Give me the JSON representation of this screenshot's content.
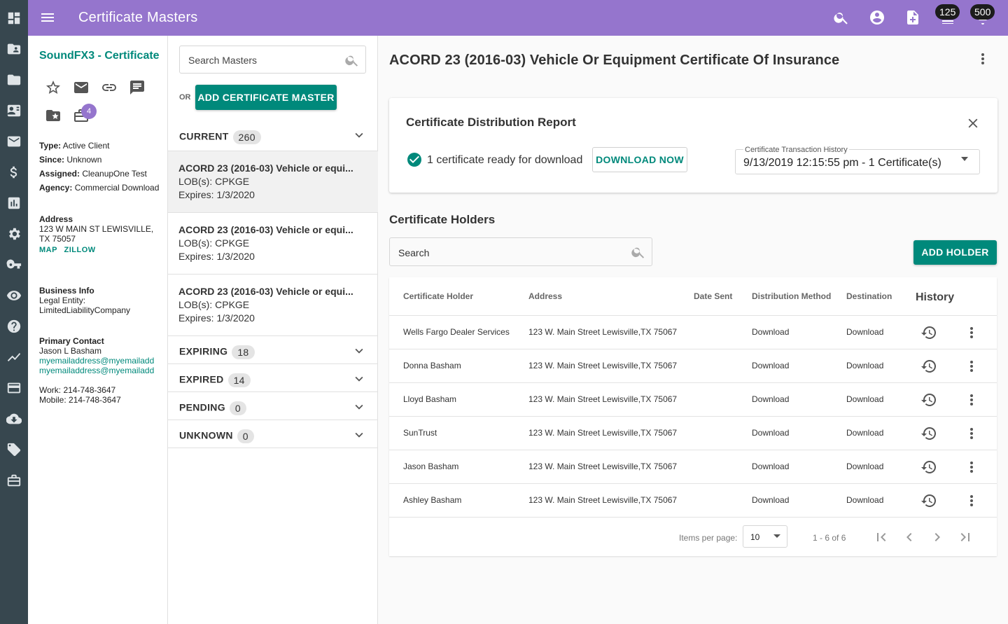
{
  "topbar": {
    "title": "Certificate Masters",
    "badge_tasks": "125",
    "badge_notifications": "500"
  },
  "rail": {
    "icons": [
      "dashboard-icon",
      "contacts-folder-icon",
      "folder-icon",
      "contact-card-icon",
      "mail-icon",
      "dollar-icon",
      "bar-chart-icon",
      "settings-icon",
      "key-icon",
      "eye-icon",
      "help-icon",
      "trending-icon",
      "credit-card-icon",
      "cloud-download-icon",
      "tag-icon",
      "briefcase-icon"
    ]
  },
  "client": {
    "name": "SoundFX3 - Certificate",
    "badge_count": "4",
    "type_label": "Type:",
    "type_value": "Active Client",
    "since_label": "Since:",
    "since_value": "Unknown",
    "assigned_label": "Assigned:",
    "assigned_value": "CleanupOne Test",
    "agency_label": "Agency:",
    "agency_value": "Commercial Download",
    "address_label": "Address",
    "address_line1": "123 W MAIN ST LEWISVILLE,",
    "address_line2": "TX 75057",
    "map_link": "MAP",
    "zillow_link": "ZILLOW",
    "business_label": "Business Info",
    "legal_label": "Legal Entity:",
    "legal_value": "LimitedLiabilityCompany",
    "contact_label": "Primary Contact",
    "contact_name": "Jason L Basham",
    "email1": "myemailaddress@myemailadd",
    "email2": "myemailaddress@myemailadd",
    "work": "Work: 214-748-3647",
    "mobile": "Mobile: 214-748-3647"
  },
  "masters": {
    "search_placeholder": "Search Masters",
    "or_label": "OR",
    "add_button": "ADD CERTIFICATE MASTER",
    "current_label": "CURRENT",
    "current_count": "260",
    "items": [
      {
        "title": "ACORD 23 (2016-03) Vehicle or equi...",
        "lob": "LOB(s): CPKGE",
        "expires": "Expires: 1/3/2020"
      },
      {
        "title": "ACORD 23 (2016-03) Vehicle or equi...",
        "lob": "LOB(s): CPKGE",
        "expires": "Expires: 1/3/2020"
      },
      {
        "title": "ACORD 23 (2016-03) Vehicle or equi...",
        "lob": "LOB(s): CPKGE",
        "expires": "Expires: 1/3/2020"
      }
    ],
    "expiring_label": "EXPIRING",
    "expiring_count": "18",
    "expired_label": "EXPIRED",
    "expired_count": "14",
    "pending_label": "PENDING",
    "pending_count": "0",
    "unknown_label": "UNKNOWN",
    "unknown_count": "0"
  },
  "detail": {
    "title": "ACORD 23 (2016-03) Vehicle Or Equipment Certificate Of Insurance",
    "report": {
      "title": "Certificate Distribution Report",
      "ready_text": "1 certificate ready for download",
      "download_button": "DOWNLOAD NOW",
      "history_label": "Certificate Transaction History",
      "history_value": "9/13/2019 12:15:55 pm - 1 Certificate(s)"
    },
    "holders_title": "Certificate Holders",
    "search_placeholder": "Search",
    "add_holder_button": "ADD HOLDER",
    "columns": {
      "holder": "Certificate Holder",
      "address": "Address",
      "date_sent": "Date Sent",
      "method": "Distribution Method",
      "destination": "Destination",
      "history": "History"
    },
    "rows": [
      {
        "holder": "Wells Fargo Dealer Services",
        "address": "123 W. Main Street Lewisville,TX 75067",
        "date_sent": "",
        "method": "Download",
        "destination": "Download"
      },
      {
        "holder": "Donna Basham",
        "address": "123 W. Main Street Lewisville,TX 75067",
        "date_sent": "",
        "method": "Download",
        "destination": "Download"
      },
      {
        "holder": "Lloyd Basham",
        "address": "123 W. Main Street Lewisville,TX 75067",
        "date_sent": "",
        "method": "Download",
        "destination": "Download"
      },
      {
        "holder": "SunTrust",
        "address": "123 W. Main Street Lewisville,TX 75067",
        "date_sent": "",
        "method": "Download",
        "destination": "Download"
      },
      {
        "holder": "Jason Basham",
        "address": "123 W. Main Street Lewisville,TX 75067",
        "date_sent": "",
        "method": "Download",
        "destination": "Download"
      },
      {
        "holder": "Ashley Basham",
        "address": "123 W. Main Street Lewisville,TX 75067",
        "date_sent": "",
        "method": "Download",
        "destination": "Download"
      }
    ],
    "pager": {
      "items_label": "Items per page:",
      "page_size": "10",
      "range": "1 - 6 of 6"
    }
  },
  "colors": {
    "rail": "#37474f",
    "topbar": "#9575cd",
    "accent": "#00897b"
  }
}
